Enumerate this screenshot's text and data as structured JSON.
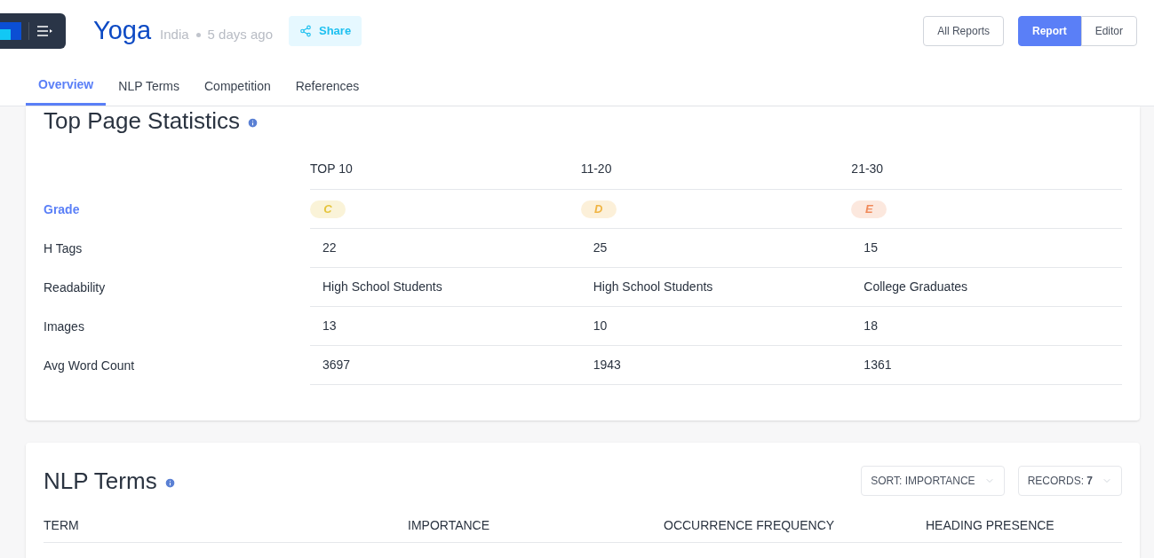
{
  "header": {
    "title": "Yoga",
    "location": "India",
    "age": "5 days ago",
    "share": "Share",
    "all_reports": "All Reports",
    "view_toggle": [
      {
        "label": "Report",
        "selected": true
      },
      {
        "label": "Editor",
        "selected": false
      }
    ]
  },
  "tabs": [
    {
      "label": "Overview",
      "selected": true
    },
    {
      "label": "NLP Terms",
      "selected": false
    },
    {
      "label": "Competition",
      "selected": false
    },
    {
      "label": "References",
      "selected": false
    }
  ],
  "statistics": {
    "title": "Top Page Statistics",
    "columns": [
      "TOP 10",
      "11-20",
      "21-30"
    ],
    "rows": [
      {
        "kind": "grade",
        "label": "Grade",
        "values": [
          {
            "text": "C",
            "color": "#e5c43a"
          },
          {
            "text": "D",
            "color": "#f0b442"
          },
          {
            "text": "E",
            "color": "#f08a5a"
          }
        ]
      },
      {
        "kind": "text",
        "label": "H Tags",
        "values": [
          {
            "text": "22"
          },
          {
            "text": "25"
          },
          {
            "text": "15"
          }
        ]
      },
      {
        "kind": "text",
        "label": "Readability",
        "values": [
          {
            "text": "High School Students"
          },
          {
            "text": "High School Students"
          },
          {
            "text": "College Graduates"
          }
        ]
      },
      {
        "kind": "text",
        "label": "Images",
        "values": [
          {
            "text": "13"
          },
          {
            "text": "10"
          },
          {
            "text": "18"
          }
        ]
      },
      {
        "kind": "text",
        "label": "Avg Word Count",
        "values": [
          {
            "text": "3697"
          },
          {
            "text": "1943"
          },
          {
            "text": "1361"
          }
        ]
      }
    ]
  },
  "nlp_terms": {
    "title": "NLP Terms",
    "sort": "SORT: IMPORTANCE",
    "records": "RECORDS: **7**",
    "columns": [
      "TERM",
      "IMPORTANCE",
      "OCCURRENCE FREQUENCY",
      "HEADING PRESENCE"
    ]
  }
}
